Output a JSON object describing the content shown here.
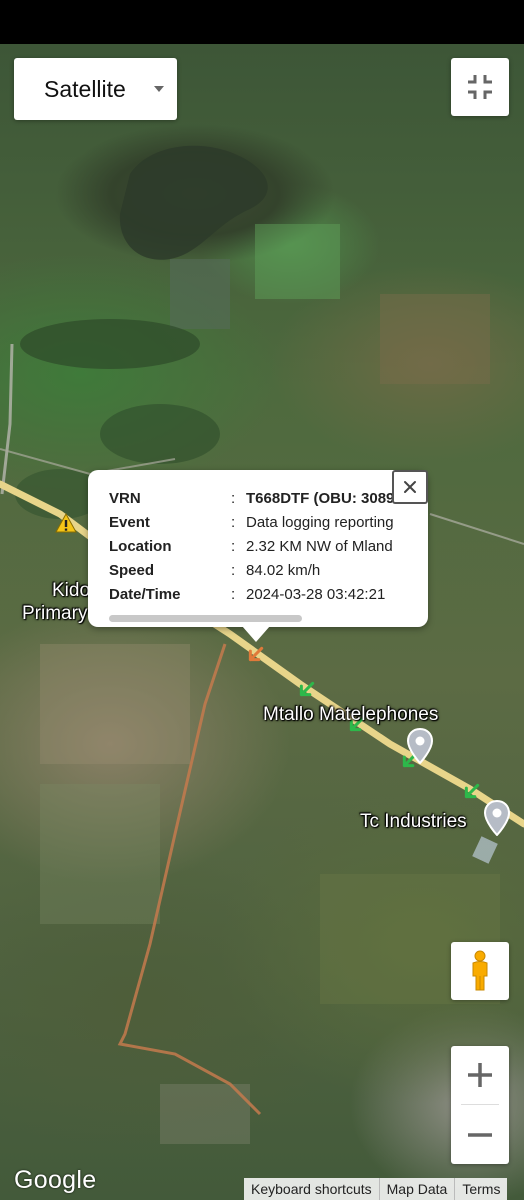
{
  "map": {
    "type_selector": {
      "selected": "Satellite"
    },
    "labels": {
      "school_partial_line1": "Kido",
      "school_partial_line2": "Primary",
      "poi_1": "Mtallo Matelephones",
      "poi_2": "Tc Industries"
    },
    "icons": {
      "fullscreen": "exit-fullscreen-icon",
      "pegman": "pegman-icon",
      "zoom_in": "plus-icon",
      "zoom_out": "minus-icon",
      "close": "close-icon",
      "warning": "warning-icon",
      "place_pin": "place-pin-icon",
      "track_arrow": "arrow-icon"
    },
    "colors": {
      "route": "#e8d58a",
      "track_arrow": "#2db84a",
      "vehicle_arrow": "#e07a3a",
      "dirt_road": "#c47a4e",
      "warning": "#f5c518"
    },
    "attribution": {
      "logo": "Google",
      "keyboard_shortcuts": "Keyboard shortcuts",
      "map_data": "Map Data",
      "terms": "Terms"
    }
  },
  "info_window": {
    "rows": [
      {
        "key": "VRN",
        "colon": ":",
        "value": "T668DTF (OBU: 3089"
      },
      {
        "key": "Event",
        "colon": ":",
        "value": "Data logging reporting"
      },
      {
        "key": "Location",
        "colon": ":",
        "value": "2.32 KM NW of Mland"
      },
      {
        "key": "Speed",
        "colon": ":",
        "value": "84.02 km/h"
      },
      {
        "key": "Date/Time",
        "colon": ":",
        "value": "2024-03-28 03:42:21"
      }
    ]
  }
}
